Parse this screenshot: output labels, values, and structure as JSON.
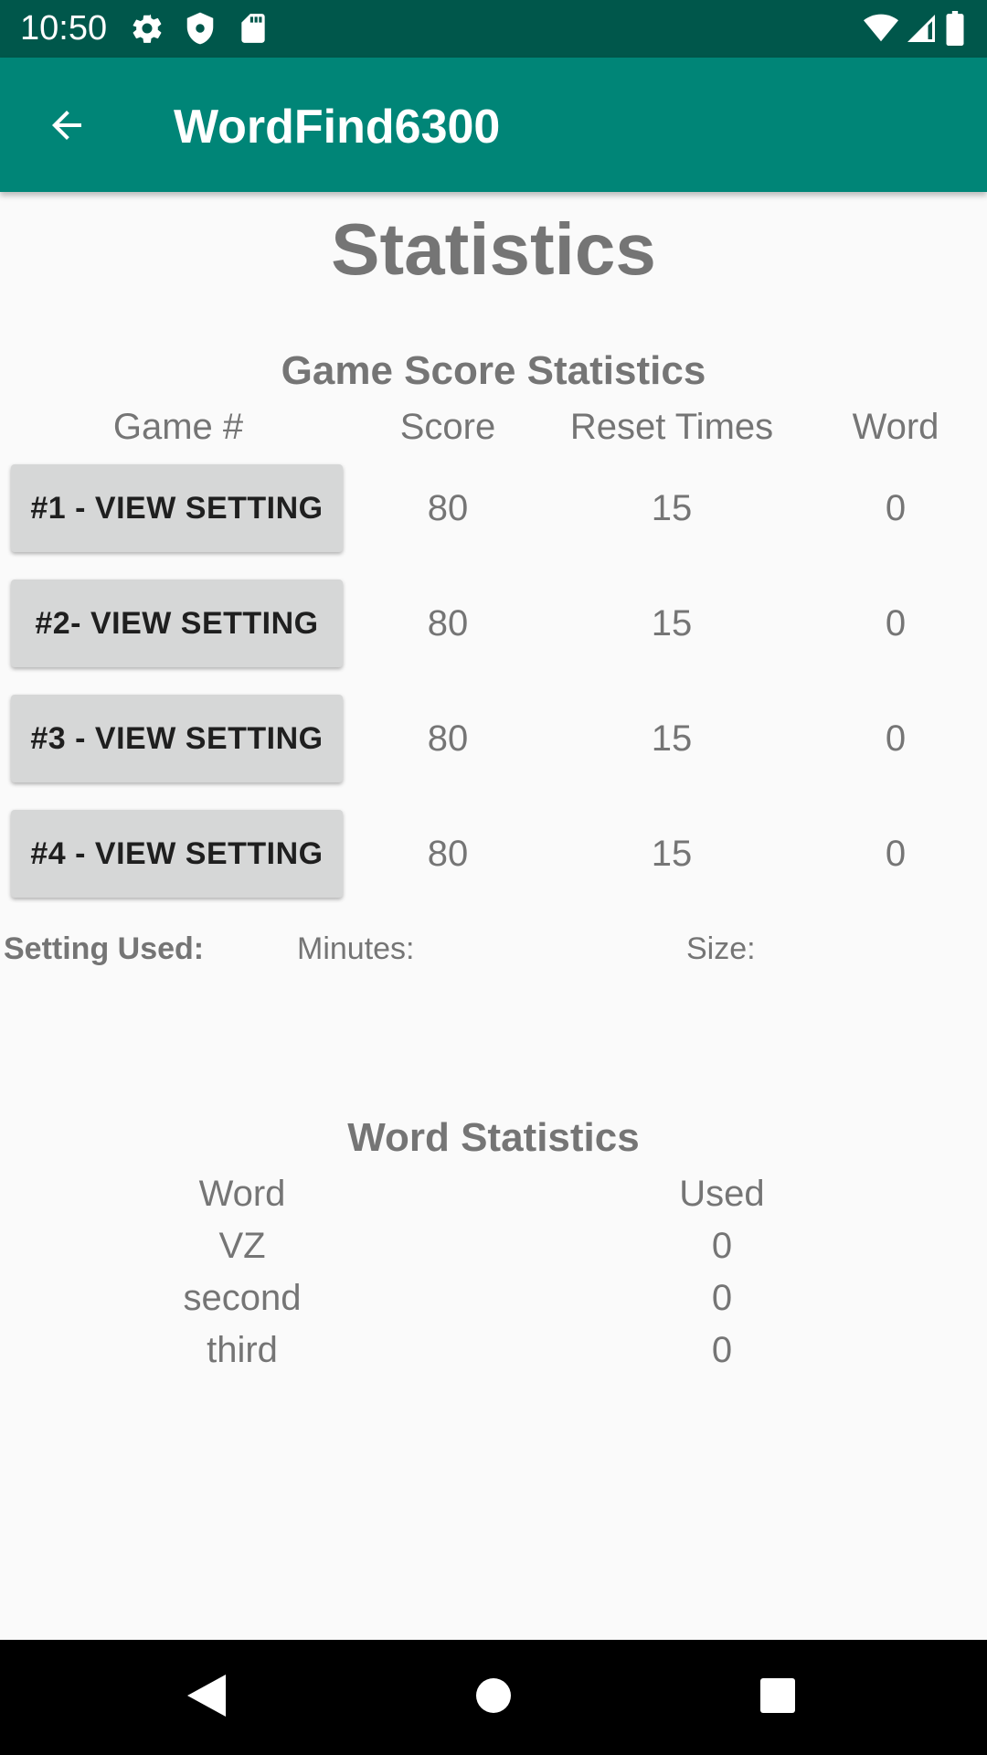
{
  "status_bar": {
    "time": "10:50",
    "left_icons": [
      "gear-icon",
      "shield-icon",
      "sd-card-icon"
    ],
    "right_icons": [
      "wifi-icon",
      "signal-icon",
      "battery-icon"
    ]
  },
  "app_bar": {
    "title": "WordFind6300",
    "back_icon": "arrow-back-icon"
  },
  "page_title": "Statistics",
  "game_score": {
    "title": "Game Score Statistics",
    "headers": {
      "game": "Game #",
      "score": "Score",
      "reset": "Reset Times",
      "word": "Word"
    },
    "rows": [
      {
        "button": "#1 - VIEW SETTING",
        "score": "80",
        "reset": "15",
        "word": "0"
      },
      {
        "button": "#2- VIEW SETTING",
        "score": "80",
        "reset": "15",
        "word": "0"
      },
      {
        "button": "#3 - VIEW SETTING",
        "score": "80",
        "reset": "15",
        "word": "0"
      },
      {
        "button": "#4 - VIEW SETTING",
        "score": "80",
        "reset": "15",
        "word": "0"
      }
    ]
  },
  "setting_used": {
    "label": "Setting Used:",
    "minutes_label": "Minutes:",
    "size_label": "Size:"
  },
  "word_stats": {
    "title": "Word Statistics",
    "headers": {
      "word": "Word",
      "used": "Used"
    },
    "rows": [
      {
        "word": "VZ",
        "used": "0"
      },
      {
        "word": "second",
        "used": "0"
      },
      {
        "word": "third",
        "used": "0"
      }
    ]
  },
  "nav_bar": {
    "icons": [
      "back-triangle-icon",
      "home-circle-icon",
      "recents-square-icon"
    ]
  },
  "colors": {
    "status_bar": "#00574b",
    "app_bar": "#008577",
    "text_gray": "#757575",
    "button_bg": "#d6d7d7"
  }
}
